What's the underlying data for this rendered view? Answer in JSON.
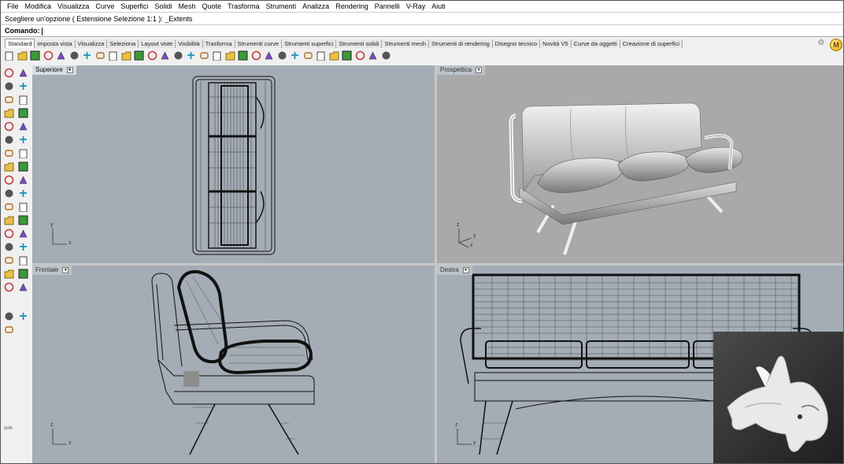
{
  "menu": [
    "File",
    "Modifica",
    "Visualizza",
    "Curve",
    "Superfici",
    "Solidi",
    "Mesh",
    "Quote",
    "Trasforma",
    "Strumenti",
    "Analizza",
    "Rendering",
    "Pannelli",
    "V-Ray",
    "Aiuti"
  ],
  "history_line": "Scegliere un'opzione ( Estensione  Selezione  1:1 ): _Extents",
  "command": {
    "label": "Comando:",
    "value": ""
  },
  "tabs": [
    "Standard",
    "Imposta vista",
    "Visualizza",
    "Seleziona",
    "Layout viste",
    "Visibilità",
    "Trasforma",
    "Strumenti curve",
    "Strumenti superfici",
    "Strumenti solidi",
    "Strumenti mesh",
    "Strumenti di rendering",
    "Disegno tecnico",
    "Novità V5",
    "Curve da oggetti",
    "Creazione di superfici"
  ],
  "rhino_badge": "M",
  "toolbar_icons": [
    "new-file-icon",
    "open-file-icon",
    "save-icon",
    "print-icon",
    "import-icon",
    "copy-icon",
    "paste-icon",
    "undo-icon",
    "pan-icon",
    "rotate-view-icon",
    "zoom-icon",
    "zoom-window-icon",
    "zoom-extents-icon",
    "zoom-selected-icon",
    "undo-view-icon",
    "four-viewports-icon",
    "car-object-icon",
    "grid-snap-icon",
    "properties-icon",
    "light-bulb-icon",
    "lock-icon",
    "material-icon",
    "color-wheel-icon",
    "render-sphere-icon",
    "render-preview-icon",
    "environment-icon",
    "vray-icon",
    "gear-icon",
    "options-icon",
    "help-icon"
  ],
  "left_tool_icons": [
    "select-arrow-icon",
    "point-icon",
    "polyline-icon",
    "polygon-icon",
    "circle-icon",
    "ellipse-icon",
    "arc-icon",
    "rectangle-icon",
    "spline-icon",
    "freeform-curve-icon",
    "surface-icon",
    "patch-icon",
    "box-icon",
    "sphere-icon",
    "extrude-icon",
    "boolean-icon",
    "mesh-icon",
    "explode-icon",
    "trim-icon",
    "split-icon",
    "fillet-icon",
    "offset-icon",
    "move-icon",
    "text-icon",
    "dimension-icon",
    "array-icon",
    "group-icon",
    "grid-icon",
    "check-icon",
    "bulb-icon",
    "bulb-on-icon",
    "lamp-icon",
    "lock-icon",
    "padlock-icon",
    "sun-icon",
    "light-icon",
    "eye-icon"
  ],
  "sun_label": "SUN",
  "viewports": {
    "top": {
      "title": "Superiore",
      "axis_x": "x",
      "axis_y": "y"
    },
    "perspective": {
      "title": "Prospettica",
      "axis_x": "x",
      "axis_y": "y",
      "axis_z": "z"
    },
    "front": {
      "title": "Frontale",
      "axis_x": "x",
      "axis_y": "z"
    },
    "right": {
      "title": "Destra",
      "axis_x": "y",
      "axis_y": "z"
    }
  },
  "colors": {
    "viewport_bg": "#a4acb5",
    "wire": "#111111",
    "active_title": "#d8dde3"
  }
}
